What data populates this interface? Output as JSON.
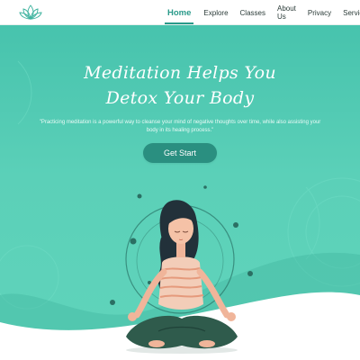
{
  "nav": {
    "logo_icon": "lotus-logo-icon",
    "links": [
      {
        "label": "Home",
        "active": true
      },
      {
        "label": "Explore",
        "active": false
      },
      {
        "label": "Classes",
        "active": false
      },
      {
        "label": "About Us",
        "active": false
      },
      {
        "label": "Privacy",
        "active": false
      },
      {
        "label": "Services",
        "active": false
      }
    ]
  },
  "hero": {
    "title_line1": "Meditation Helps You",
    "title_line2": "Detox Your Body",
    "quote": "\"Practicing meditation is a powerful way to cleanse your mind of negative thoughts over time, while also assisting your body in its healing process.\"",
    "cta_label": "Get Start",
    "illustration_icon": "meditating-woman-illustration"
  },
  "colors": {
    "accent": "#2a9a8a",
    "hero_bg": "#53cbb3",
    "button": "#2a8f80",
    "nav_text": "#2b3b38"
  }
}
